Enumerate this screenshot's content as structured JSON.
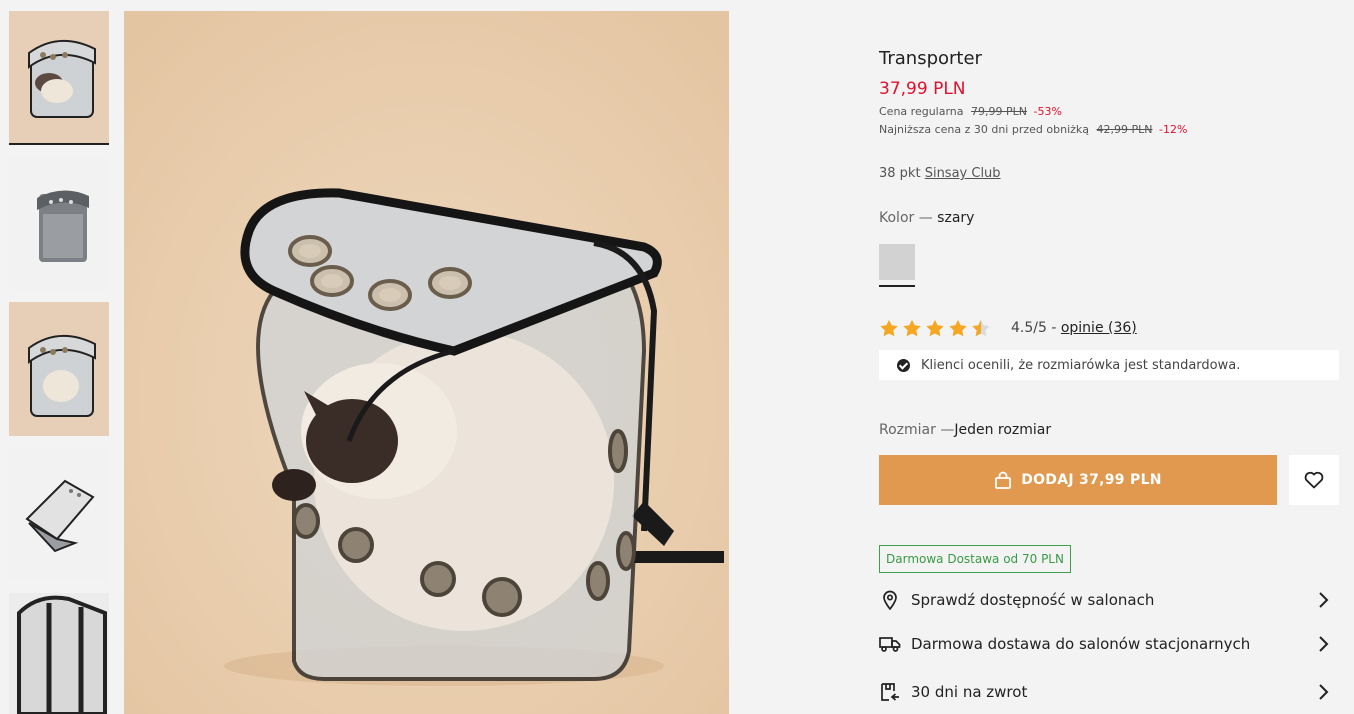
{
  "gallery": {
    "thumbnails": [
      {
        "name": "thumb-1",
        "active": true
      },
      {
        "name": "thumb-2",
        "active": false
      },
      {
        "name": "thumb-3",
        "active": false
      },
      {
        "name": "thumb-4",
        "active": false
      },
      {
        "name": "thumb-5",
        "active": false
      }
    ]
  },
  "product": {
    "title": "Transporter",
    "price": "37,99 PLN",
    "regular_label": "Cena regularna",
    "regular_price": "79,99 PLN",
    "regular_discount": "-53%",
    "lowest_label": "Najniższa cena z 30 dni przed obniżką",
    "lowest_price": "42,99 PLN",
    "lowest_discount": "-12%",
    "points_prefix": "38 pkt",
    "club_link": "Sinsay Club",
    "color_label": "Kolor —",
    "color_value": "szary",
    "swatch_color": "#d2d2d2",
    "rating_value": "4.5/5 -",
    "rating_stars": 4.5,
    "reviews_link": "opinie (36)",
    "fit_note": "Klienci ocenili, że rozmiarówka jest standardowa.",
    "size_label": "Rozmiar —",
    "size_value": "Jeden rozmiar",
    "add_button": "DODAJ 37,99 PLN",
    "free_badge": "Darmowa Dostawa od 70 PLN"
  },
  "links": [
    {
      "label": "Sprawdź dostępność w salonach",
      "icon": "location-pin-icon"
    },
    {
      "label": "Darmowa dostawa do salonów stacjonarnych",
      "icon": "delivery-truck-icon"
    },
    {
      "label": "30 dni na zwrot",
      "icon": "return-box-icon"
    }
  ],
  "colors": {
    "accent": "#e0994e",
    "price_red": "#e0112b",
    "star": "#f5a623",
    "badge_green": "#3aa14a"
  }
}
